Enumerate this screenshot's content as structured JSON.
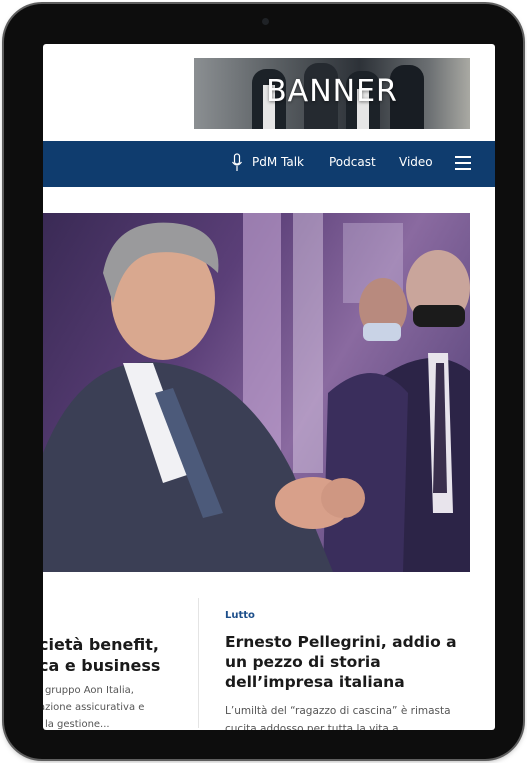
{
  "banner": {
    "text": "BANNER"
  },
  "nav": {
    "items": [
      {
        "label": "PdM Talk",
        "icon": "microphone-icon"
      },
      {
        "label": "Podcast"
      },
      {
        "label": "Video"
      }
    ],
    "menu_icon": "hamburger-menu-icon"
  },
  "colors": {
    "nav_background": "#0f3c6e",
    "category": "#1d4f8b"
  },
  "hero": {
    "image": "man-in-suit-speaking-photo"
  },
  "articles": [
    {
      "title_lines": [
        "cietà benefit,",
        "ca e business"
      ],
      "excerpt_lines": [
        "l gruppo Aon Italia,",
        "azione assicurativa e",
        "i la gestione..."
      ]
    },
    {
      "category": "Lutto",
      "title": "Ernesto Pellegrini, addio a un pezzo di storia dell’impresa italiana",
      "excerpt": "L’umiltà del “ragazzo di cascina” è rimasta cucita addosso per tutta la vita a..."
    }
  ]
}
